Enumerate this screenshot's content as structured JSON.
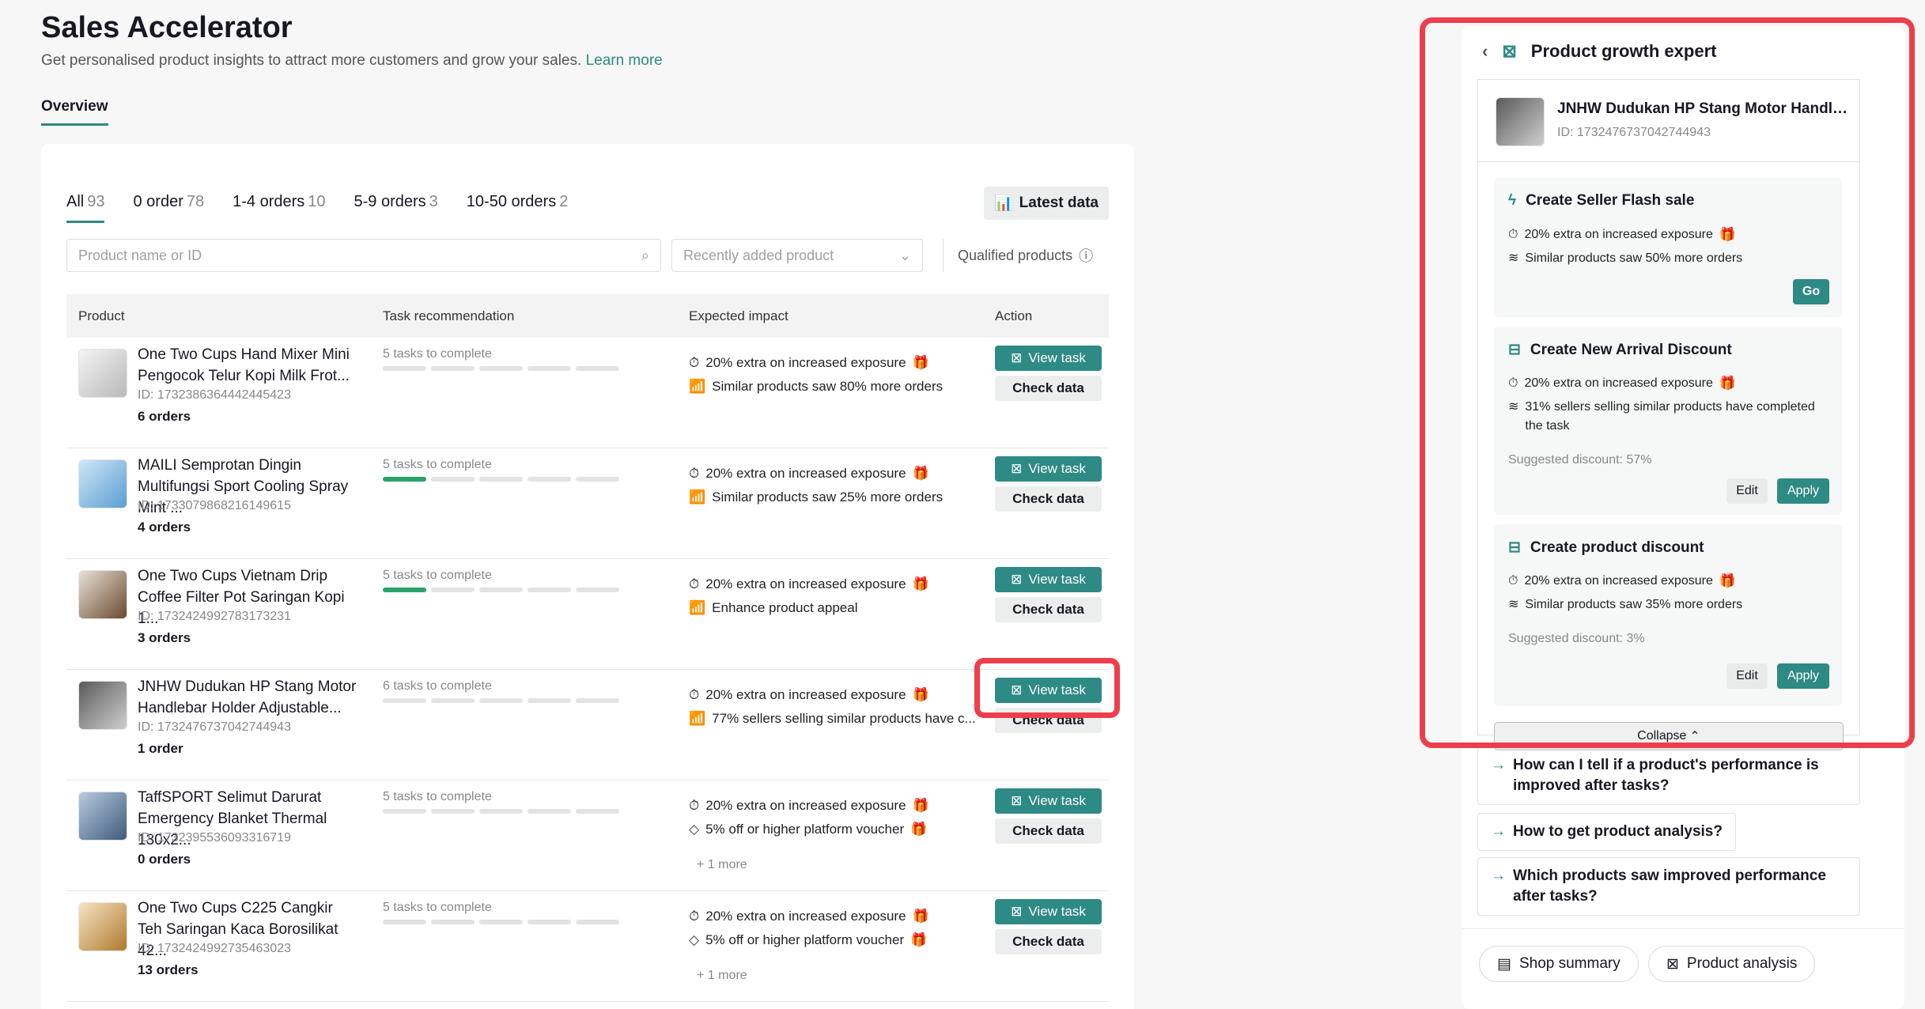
{
  "header": {
    "title": "Sales Accelerator",
    "subtitle": "Get personalised product insights to attract more customers and grow your sales.",
    "learn_more": "Learn more",
    "tab": "Overview"
  },
  "filters": [
    {
      "label": "All",
      "count": "93"
    },
    {
      "label": "0 order",
      "count": "78"
    },
    {
      "label": "1-4 orders",
      "count": "10"
    },
    {
      "label": "5-9 orders",
      "count": "3"
    },
    {
      "label": "10-50 orders",
      "count": "2"
    }
  ],
  "toolbar": {
    "latest_data": "Latest data",
    "search_placeholder": "Product name or ID",
    "sort_placeholder": "Recently added product",
    "qualified": "Qualified products"
  },
  "table": {
    "headers": [
      "Product",
      "Task recommendation",
      "Expected impact",
      "Action"
    ],
    "view_task": "View task",
    "check_data": "Check data",
    "rows": [
      {
        "name": "One Two Cups Hand Mixer Mini Pengocok Telur Kopi Milk Frot...",
        "id": "ID: 1732386364442445423",
        "orders": "6 orders",
        "tasks": "5 tasks to complete",
        "progress": 0,
        "impact1": "20% extra on increased exposure",
        "impact2": "Similar products saw 80% more orders",
        "more": ""
      },
      {
        "name": "MAILI Semprotan Dingin Multifungsi Sport Cooling Spray Mint ...",
        "id": "ID: 1733079868216149615",
        "orders": "4 orders",
        "tasks": "5 tasks to complete",
        "progress": 1,
        "impact1": "20% extra on increased exposure",
        "impact2": "Similar products saw 25% more orders",
        "more": ""
      },
      {
        "name": "One Two Cups Vietnam Drip Coffee Filter Pot Saringan Kopi 1...",
        "id": "ID: 1732424992783173231",
        "orders": "3 orders",
        "tasks": "5 tasks to complete",
        "progress": 1,
        "impact1": "20% extra on increased exposure",
        "impact2": "Enhance product appeal",
        "more": ""
      },
      {
        "name": "JNHW Dudukan HP Stang Motor Handlebar Holder Adjustable...",
        "id": "ID: 1732476737042744943",
        "orders": "1 order",
        "tasks": "6 tasks to complete",
        "progress": 0,
        "impact1": "20% extra on increased exposure",
        "impact2": "77% sellers selling similar products have c...",
        "more": ""
      },
      {
        "name": "TaffSPORT Selimut Darurat Emergency Blanket Thermal 130x2...",
        "id": "ID: 1732395536093316719",
        "orders": "0 orders",
        "tasks": "5 tasks to complete",
        "progress": 0,
        "impact1": "20% extra on increased exposure",
        "impact2": "5% off or higher platform voucher",
        "more": "+ 1 more"
      },
      {
        "name": "One Two Cups C225 Cangkir Teh Saringan Kaca Borosilikat 42...",
        "id": "ID: 1732424992735463023",
        "orders": "13 orders",
        "tasks": "5 tasks to complete",
        "progress": 0,
        "impact1": "20% extra on increased exposure",
        "impact2": "5% off or higher platform voucher",
        "more": "+ 1 more"
      }
    ]
  },
  "panel": {
    "title": "Product growth expert",
    "product_name": "JNHW Dudukan HP Stang Motor Handlebar Holder Adjustable",
    "product_id": "ID: 1732476737042744943",
    "cards": [
      {
        "title": "Create Seller Flash sale",
        "line1": "20% extra on increased exposure",
        "line2": "Similar products saw 50% more orders",
        "suggested": "",
        "go": "Go"
      },
      {
        "title": "Create New Arrival Discount",
        "line1": "20% extra on increased exposure",
        "line2": "31% sellers selling similar products have completed the task",
        "suggested": "Suggested discount: 57%",
        "edit": "Edit",
        "apply": "Apply"
      },
      {
        "title": "Create product discount",
        "line1": "20% extra on increased exposure",
        "line2": "Similar products saw 35% more orders",
        "suggested": "Suggested discount: 3%",
        "edit": "Edit",
        "apply": "Apply"
      }
    ],
    "collapse": "Collapse",
    "faqs": [
      "How can I tell if a product's performance is improved after tasks?",
      "How to get product analysis?",
      "Which products saw improved performance after tasks?"
    ],
    "footer": {
      "shop_summary": "Shop summary",
      "product_analysis": "Product analysis"
    }
  },
  "colors": {
    "accent": "#2e8a84",
    "highlight": "#ee3e4c",
    "progress": "#2aa36b"
  }
}
